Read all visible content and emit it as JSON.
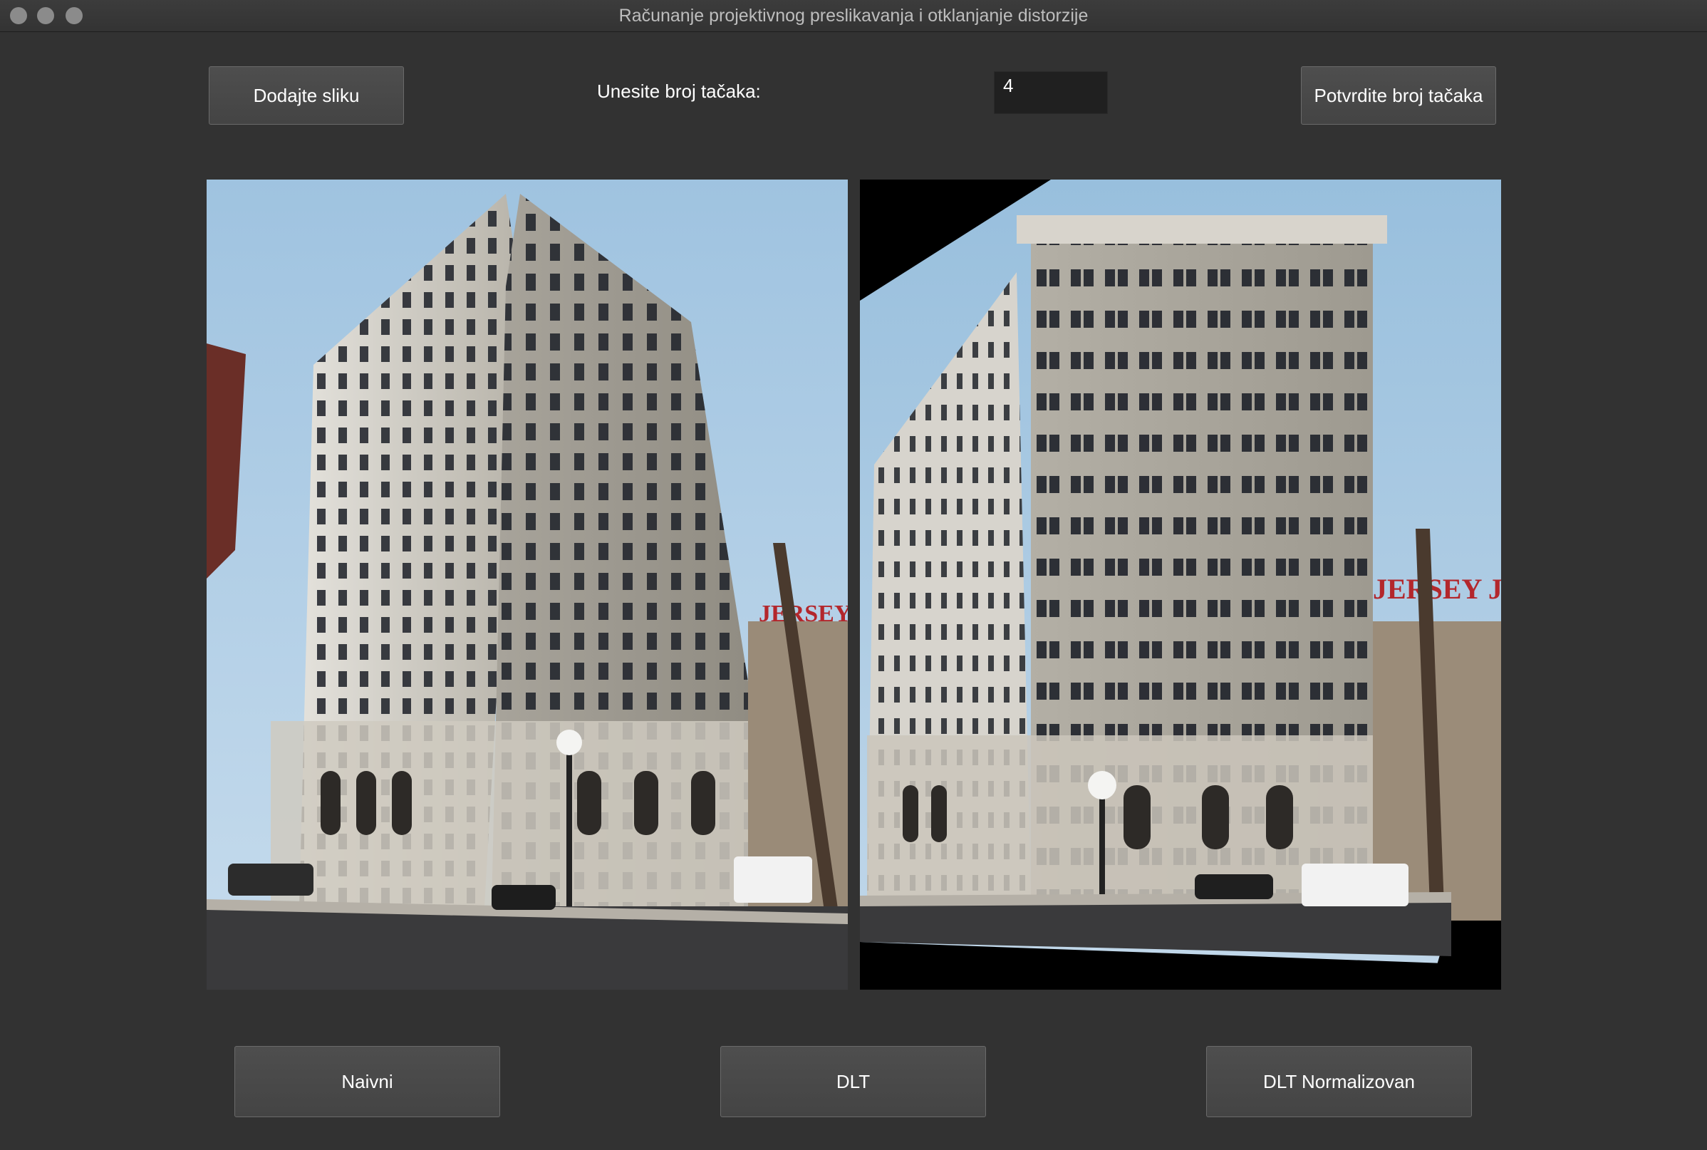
{
  "window": {
    "title": "Računanje projektivnog preslikavanja i otklanjanje distorzije"
  },
  "toolbar": {
    "add_image_label": "Dodajte sliku",
    "points_prompt": "Unesite broj tačaka:",
    "points_value": "4",
    "confirm_label": "Potvrdite broj tačaka"
  },
  "images": {
    "original_sign": "JERSEY JOUR",
    "corrected_sign": "JERSEY JOUR"
  },
  "actions": {
    "naive_label": "Naivni",
    "dlt_label": "DLT",
    "dlt_normalized_label": "DLT Normalizovan"
  }
}
